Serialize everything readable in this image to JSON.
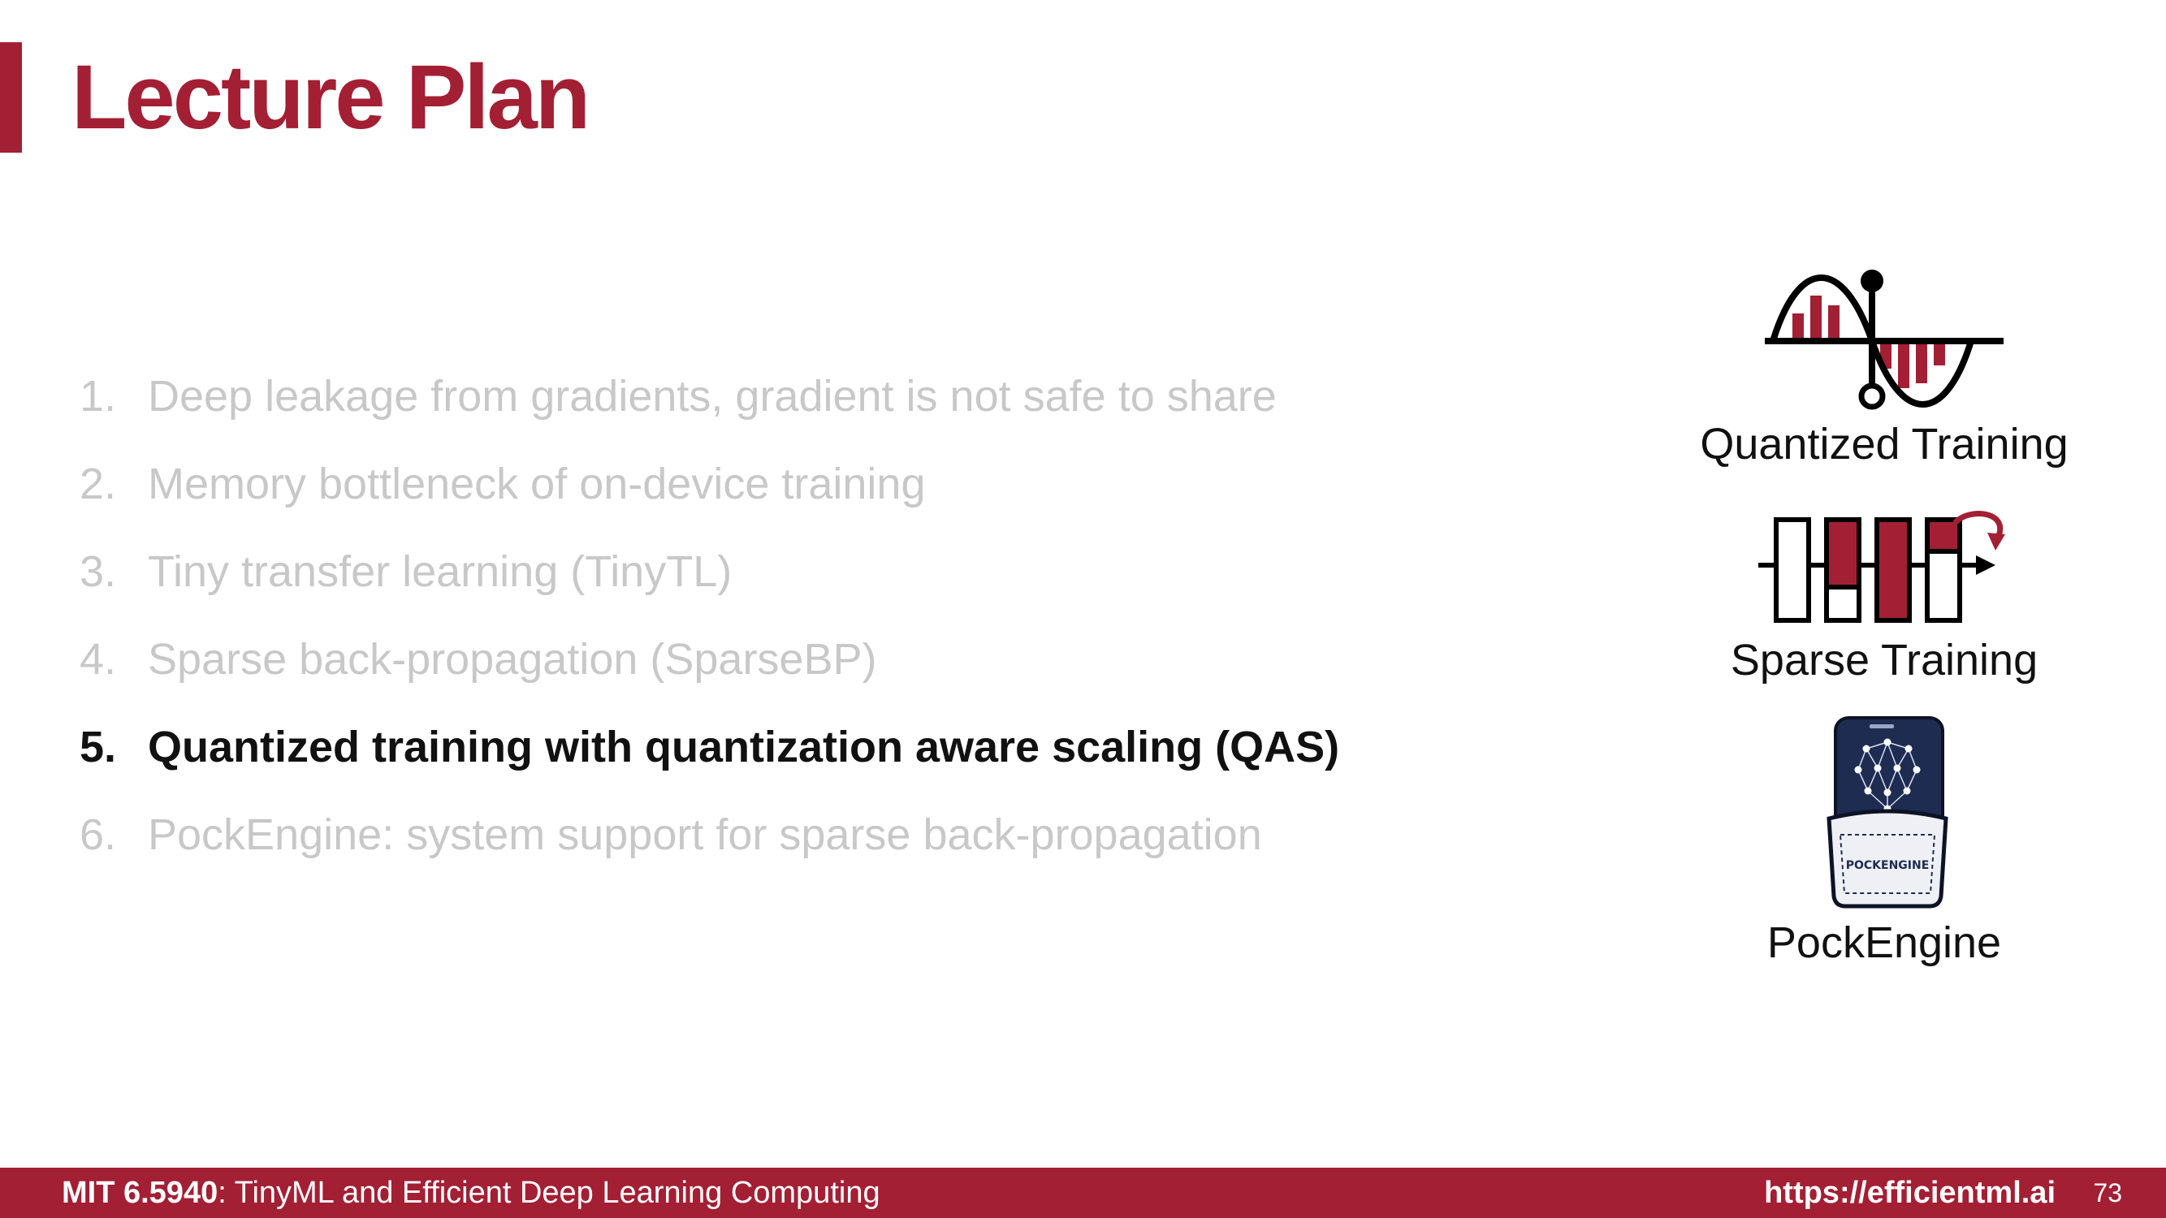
{
  "slide": {
    "title": "Lecture Plan",
    "accent_color": "#a31f34"
  },
  "agenda": [
    {
      "number": "1.",
      "text": "Deep leakage from gradients, gradient is not safe to share",
      "active": false
    },
    {
      "number": "2.",
      "text": "Memory bottleneck of on-device training",
      "active": false
    },
    {
      "number": "3.",
      "text": "Tiny transfer learning (TinyTL)",
      "active": false
    },
    {
      "number": "4.",
      "text": "Sparse back-propagation (SparseBP)",
      "active": false
    },
    {
      "number": "5.",
      "text": "Quantized training with quantization aware scaling (QAS)",
      "active": true
    },
    {
      "number": "6.",
      "text": "PockEngine: system support for sparse back-propagation",
      "active": false
    }
  ],
  "icons": [
    {
      "name": "quantized-training-icon",
      "label": "Quantized Training"
    },
    {
      "name": "sparse-training-icon",
      "label": "Sparse Training"
    },
    {
      "name": "pockengine-icon",
      "label": "PockEngine",
      "logo_text": "POCKENGINE"
    }
  ],
  "footer": {
    "course_code": "MIT 6.5940",
    "course_name": ": TinyML and Efficient Deep Learning Computing",
    "url": "https://efficientml.ai",
    "page": "73"
  }
}
